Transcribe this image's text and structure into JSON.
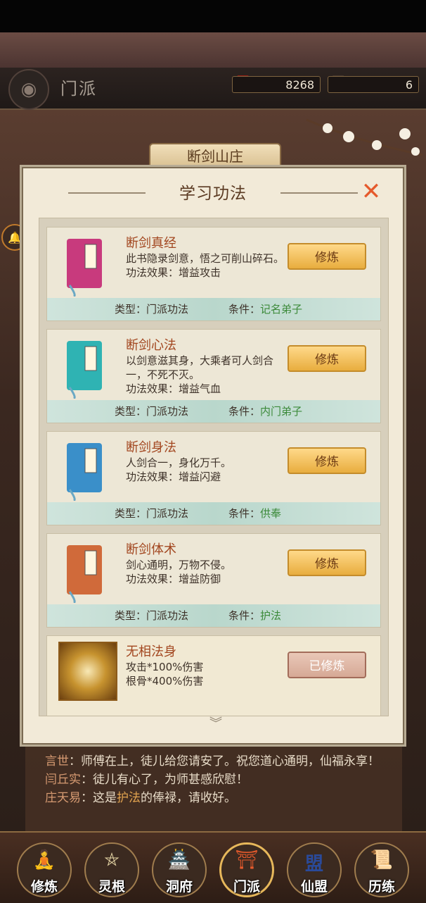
{
  "header": {
    "title": "门派",
    "resource1_value": "8268",
    "resource2_value": "6"
  },
  "scene": {
    "sect_name": "断剑山庄"
  },
  "modal": {
    "title": "学习功法",
    "close_icon": "close-icon"
  },
  "skills": [
    {
      "name": "断剑真经",
      "desc": "此书隐录剑意，悟之可削山碎石。",
      "effect": "功法效果：增益攻击",
      "type": "类型：门派功法",
      "cond_label": "条件：",
      "cond_value": "记名弟子",
      "button": "修炼",
      "book_color": "#c83a7d",
      "book_glyph": "真经"
    },
    {
      "name": "断剑心法",
      "desc": "以剑意滋其身，大乘者可人剑合一，不死不灭。",
      "effect": "功法效果：增益气血",
      "type": "类型：门派功法",
      "cond_label": "条件：",
      "cond_value": "内门弟子",
      "button": "修炼",
      "book_color": "#2fb3b3",
      "book_glyph": "心法"
    },
    {
      "name": "断剑身法",
      "desc": "人剑合一，身化万千。",
      "effect": "功法效果：增益闪避",
      "type": "类型：门派功法",
      "cond_label": "条件：",
      "cond_value": "供奉",
      "button": "修炼",
      "book_color": "#3a8fc9",
      "book_glyph": "身法"
    },
    {
      "name": "断剑体术",
      "desc": "剑心通明，万物不侵。",
      "effect": "功法效果：增益防御",
      "type": "类型：门派功法",
      "cond_label": "条件：",
      "cond_value": "护法",
      "button": "修炼",
      "book_color": "#d06a3a",
      "book_glyph": "体术"
    },
    {
      "name": "无相法身",
      "line1": "攻击*100%伤害",
      "line2": "根骨*400%伤害",
      "button": "已修炼"
    }
  ],
  "chat": [
    {
      "speaker": "言世",
      "text": "：师傅在上，徒儿给您请安了。祝您道心通明，仙福永享！"
    },
    {
      "speaker": "闫丘实",
      "text": "：徒儿有心了，为师甚感欣慰！"
    },
    {
      "speaker": "庄天易",
      "pre": "：这是",
      "highlight": "护法",
      "post": "的俸禄，请收好。"
    }
  ],
  "nav": [
    {
      "label": "修炼",
      "glyph": "🧘"
    },
    {
      "label": "灵根",
      "glyph": "⛤"
    },
    {
      "label": "洞府",
      "glyph": "🏯"
    },
    {
      "label": "门派",
      "glyph": "⛩"
    },
    {
      "label": "仙盟",
      "glyph": "盟"
    },
    {
      "label": "历练",
      "glyph": "📜"
    }
  ]
}
